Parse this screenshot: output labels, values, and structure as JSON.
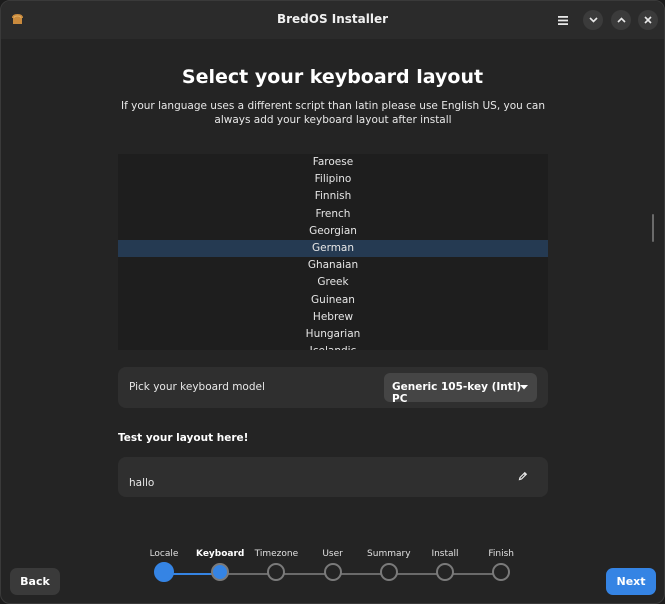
{
  "window": {
    "title": "BredOS Installer",
    "app_icon": "bread-icon",
    "controls": [
      "menu-icon",
      "minimize-icon",
      "maximize-icon",
      "close-icon"
    ]
  },
  "page": {
    "heading": "Select your keyboard layout",
    "subtitle": "If your language uses a different script than latin please use English US, you can always add your keyboard layout after install"
  },
  "layout_list": {
    "items": [
      "Faroese",
      "Filipino",
      "Finnish",
      "French",
      "Georgian",
      "German",
      "Ghanaian",
      "Greek",
      "Guinean",
      "Hebrew",
      "Hungarian",
      "Icelandic"
    ],
    "selected": "German"
  },
  "keyboard_model": {
    "label": "Pick your keyboard model",
    "value": "Generic 105-key (Intl) PC"
  },
  "test": {
    "label": "Test your layout here!",
    "value": "hallo"
  },
  "steps": {
    "items": [
      "Locale",
      "Keyboard",
      "Timezone",
      "User",
      "Summary",
      "Install",
      "Finish"
    ],
    "current": "Keyboard"
  },
  "buttons": {
    "back": "Back",
    "next": "Next"
  },
  "colors": {
    "accent": "#3584e4",
    "selection": "#253a52",
    "window_bg": "#242424"
  }
}
